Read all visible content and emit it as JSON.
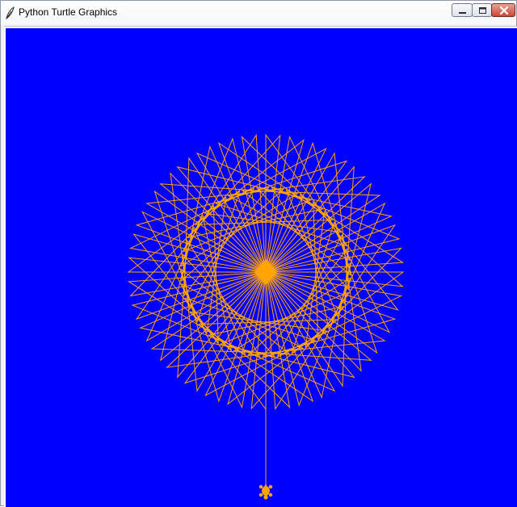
{
  "window": {
    "title": "Python Turtle Graphics",
    "app_icon": "feather-icon",
    "controls": [
      "minimize-icon",
      "maximize-icon",
      "close-icon"
    ]
  },
  "canvas": {
    "background_color": "#0000ff",
    "pen_color": "#ffa500",
    "turtle_shape": "turtle",
    "turtle_color": "#ffa500",
    "turtle_heading": "down",
    "drawing": {
      "shape": "star",
      "count": 36,
      "star_points": 5,
      "turn_angle_degrees": 144,
      "rotation_between_stars_degrees": 10,
      "center_fill": "#ffa500"
    }
  }
}
